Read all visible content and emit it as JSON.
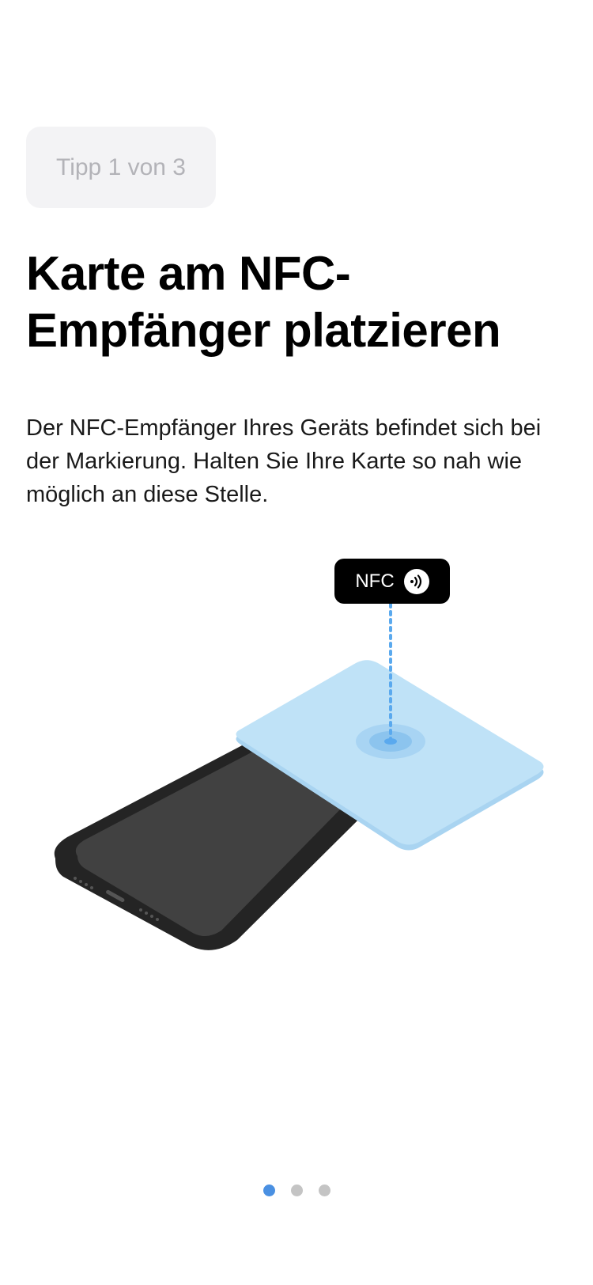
{
  "tip": {
    "counter": "Tipp 1 von 3"
  },
  "content": {
    "title": "Karte am NFC-Empfänger platzieren",
    "description": "Der NFC-Empfänger Ihres Geräts befindet sich bei der Markierung. Halten Sie Ihre Karte so nah wie möglich an diese Stelle."
  },
  "illustration": {
    "nfc_label": "NFC",
    "nfc_icon": "contactless-icon",
    "phone_icon": "smartphone-illustration",
    "card_icon": "card-illustration"
  },
  "pagination": {
    "total": 3,
    "active_index": 0,
    "active_color": "#4a90e2",
    "inactive_color": "#c4c4c4"
  },
  "colors": {
    "card": "#bfe2f7",
    "card_edge": "#a9d4f1",
    "dotted_line": "#5aa9ee",
    "phone_body": "#242424",
    "phone_screen": "#414141"
  }
}
